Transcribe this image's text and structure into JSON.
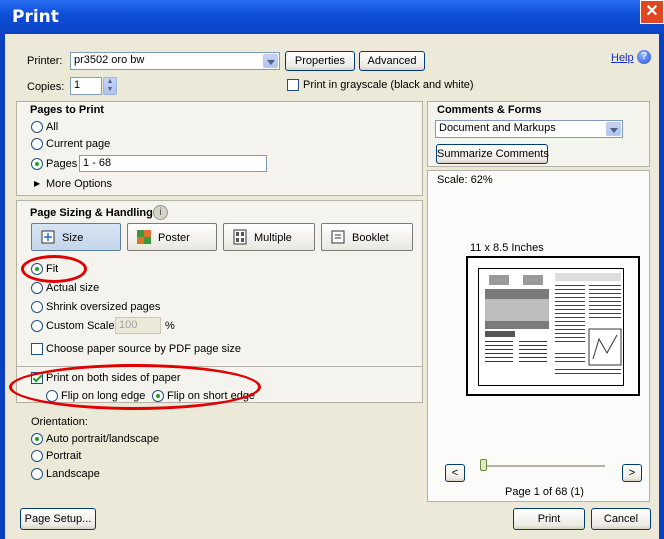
{
  "window": {
    "title": "Print",
    "help_label": "Help"
  },
  "printer": {
    "label": "Printer:",
    "value": "pr3502 oro bw",
    "properties_label": "Properties",
    "advanced_label": "Advanced",
    "copies_label": "Copies:",
    "copies_value": "1",
    "grayscale_label": "Print in grayscale (black and white)",
    "grayscale_checked": false
  },
  "pages_to_print": {
    "title": "Pages to Print",
    "all_label": "All",
    "current_label": "Current page",
    "pages_label": "Pages",
    "pages_value": "1 - 68",
    "more_options_label": "More Options",
    "selected": "pages"
  },
  "sizing": {
    "title": "Page Sizing & Handling",
    "tabs": [
      {
        "label": "Size",
        "icon": "size-icon",
        "active": true
      },
      {
        "label": "Poster",
        "icon": "poster-icon",
        "active": false
      },
      {
        "label": "Multiple",
        "icon": "multiple-icon",
        "active": false
      },
      {
        "label": "Booklet",
        "icon": "booklet-icon",
        "active": false
      }
    ],
    "fit_label": "Fit",
    "actual_label": "Actual size",
    "shrink_label": "Shrink oversized pages",
    "custom_label": "Custom Scale:",
    "custom_value": "100",
    "percent_label": "%",
    "paper_source_label": "Choose paper source by PDF page size",
    "selected": "fit"
  },
  "duplex": {
    "both_sides_label": "Print on both sides of paper",
    "both_sides_checked": true,
    "long_edge_label": "Flip on long edge",
    "short_edge_label": "Flip on short edge",
    "selected": "short"
  },
  "orientation": {
    "label": "Orientation:",
    "auto_label": "Auto portrait/landscape",
    "portrait_label": "Portrait",
    "landscape_label": "Landscape",
    "selected": "auto"
  },
  "comments": {
    "title": "Comments & Forms",
    "value": "Document and Markups",
    "summarize_label": "Summarize Comments"
  },
  "preview": {
    "scale_label": "Scale:  62%",
    "paper_size": "11 x 8.5 Inches",
    "prev_label": "<",
    "next_label": ">",
    "page_info": "Page 1 of 68 (1)",
    "slider_position": 0
  },
  "footer": {
    "page_setup_label": "Page Setup...",
    "print_label": "Print",
    "cancel_label": "Cancel"
  },
  "colors": {
    "titlebar": "#0f4fd8",
    "annotation": "#e00000",
    "radio_dot": "#21a121"
  }
}
